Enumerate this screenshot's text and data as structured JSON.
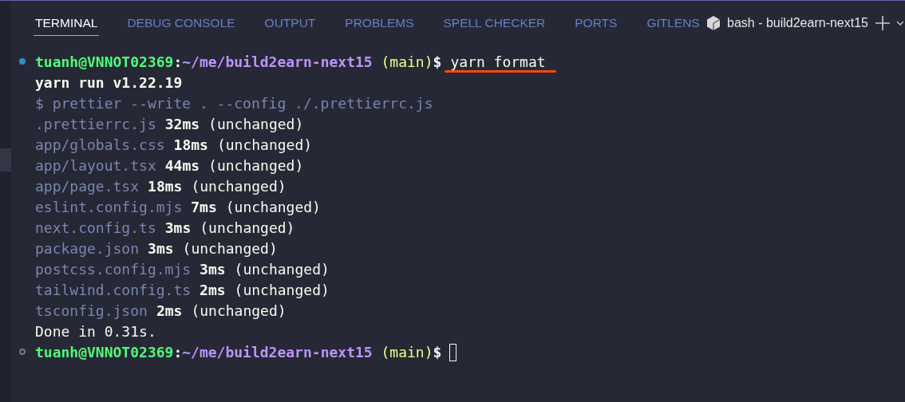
{
  "panel_tabs": [
    {
      "label": "TERMINAL",
      "selected": true
    },
    {
      "label": "DEBUG CONSOLE",
      "selected": false
    },
    {
      "label": "OUTPUT",
      "selected": false
    },
    {
      "label": "PROBLEMS",
      "selected": false
    },
    {
      "label": "SPELL CHECKER",
      "selected": false
    },
    {
      "label": "PORTS",
      "selected": false
    },
    {
      "label": "GITLENS",
      "selected": false
    }
  ],
  "terminal_selector": {
    "label": "bash - build2earn-next15"
  },
  "terminal_lines": [
    {
      "kind": "prompt",
      "succeeded": true,
      "user_host": "tuanh@VNNOT02369",
      "colon": ":",
      "path": "~/me/build2earn-next15",
      "branch": "(main)",
      "dollar": "$",
      "command": "yarn format",
      "underlined": true
    },
    {
      "kind": "banner",
      "text": "yarn run v1.22.19"
    },
    {
      "kind": "echo",
      "text": "$ prettier --write . --config ./.prettierrc.js"
    },
    {
      "kind": "result",
      "file": ".prettierrc.js",
      "time": "32ms",
      "status": "(unchanged)"
    },
    {
      "kind": "result",
      "file": "app/globals.css",
      "time": "18ms",
      "status": "(unchanged)"
    },
    {
      "kind": "result",
      "file": "app/layout.tsx",
      "time": "44ms",
      "status": "(unchanged)"
    },
    {
      "kind": "result",
      "file": "app/page.tsx",
      "time": "18ms",
      "status": "(unchanged)"
    },
    {
      "kind": "result",
      "file": "eslint.config.mjs",
      "time": "7ms",
      "status": "(unchanged)"
    },
    {
      "kind": "result",
      "file": "next.config.ts",
      "time": "3ms",
      "status": "(unchanged)"
    },
    {
      "kind": "result",
      "file": "package.json",
      "time": "3ms",
      "status": "(unchanged)"
    },
    {
      "kind": "result",
      "file": "postcss.config.mjs",
      "time": "3ms",
      "status": "(unchanged)"
    },
    {
      "kind": "result",
      "file": "tailwind.config.ts",
      "time": "2ms",
      "status": "(unchanged)"
    },
    {
      "kind": "result",
      "file": "tsconfig.json",
      "time": "2ms",
      "status": "(unchanged)"
    },
    {
      "kind": "summary",
      "text": "Done in 0.31s."
    },
    {
      "kind": "prompt",
      "succeeded": false,
      "user_host": "tuanh@VNNOT02369",
      "colon": ":",
      "path": "~/me/build2earn-next15",
      "branch": "(main)",
      "dollar": "$",
      "cursor": true
    }
  ]
}
